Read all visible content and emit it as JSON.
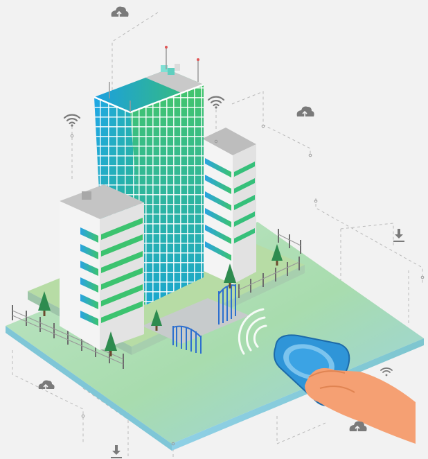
{
  "illustration": {
    "subject": "smart-building-contactless-access",
    "colors": {
      "background": "#f2f2f2",
      "ground_green": "#a8dcae",
      "ground_blue": "#9ad2e6",
      "tower_green": "#36c07a",
      "tower_blue": "#1f9fe0",
      "tag_blue": "#2f95d8",
      "hand_skin": "#f5a073",
      "icon_gray": "#7a7a7a",
      "gate_blue": "#2d6fcf"
    },
    "icons": [
      "cloud-upload-icon",
      "wifi-icon",
      "download-arrow-icon",
      "nfc-wave-icon",
      "tree-icon",
      "gate-icon"
    ]
  }
}
